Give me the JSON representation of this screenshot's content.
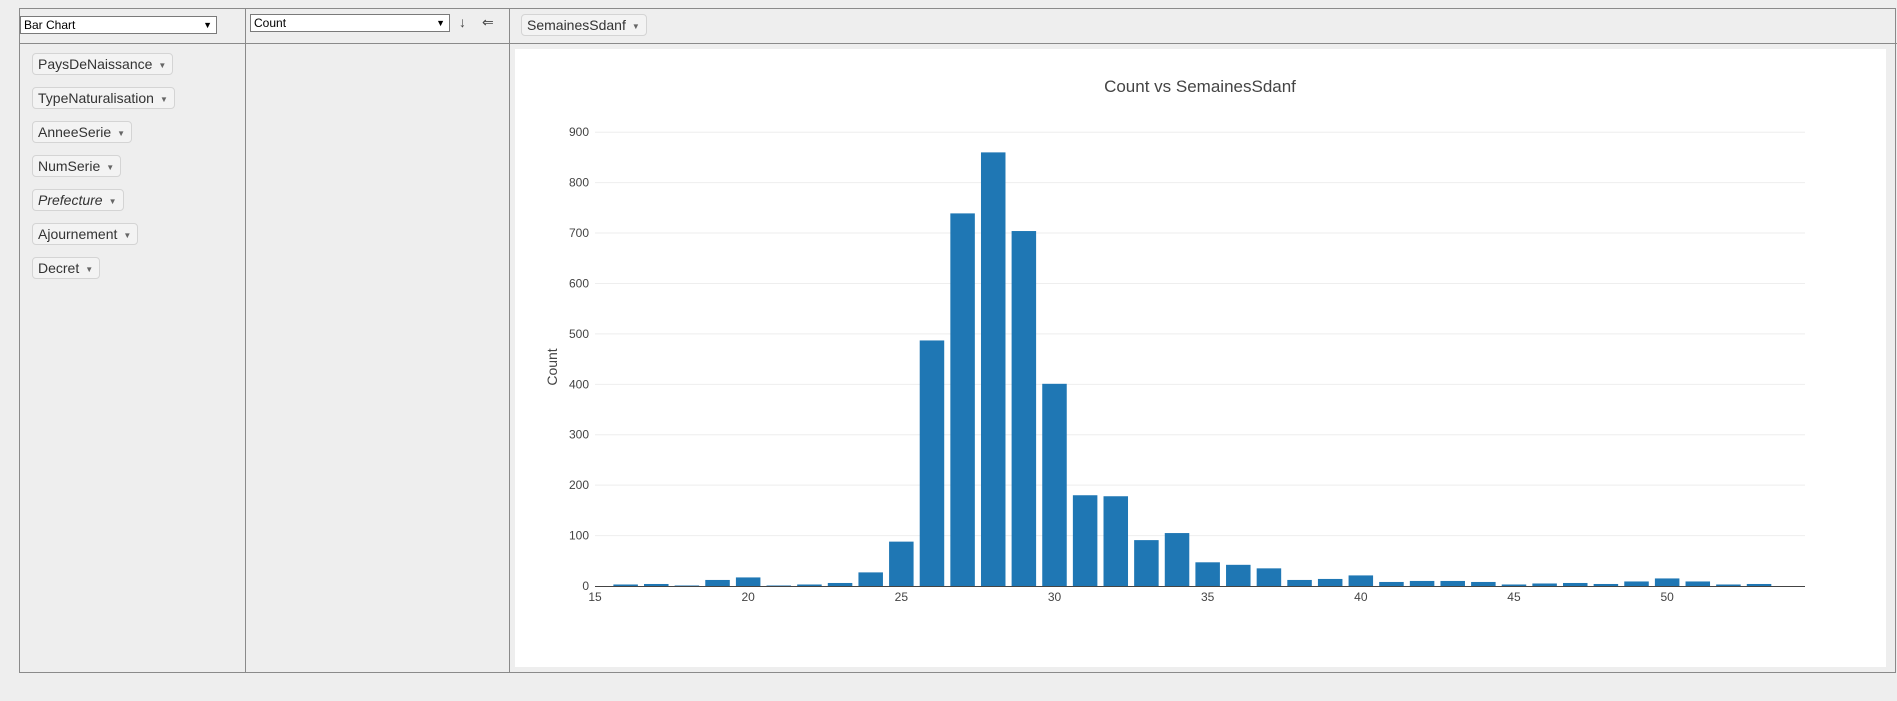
{
  "renderer": {
    "selected": "Bar Chart"
  },
  "aggregator": {
    "selected": "Count"
  },
  "sort_icons": {
    "rows": "↓",
    "cols": "⇐"
  },
  "column_attributes": [
    {
      "label": "SemainesSdanf"
    }
  ],
  "unused_attributes": [
    {
      "label": "PaysDeNaissance",
      "italic": false
    },
    {
      "label": "TypeNaturalisation",
      "italic": false
    },
    {
      "label": "AnneeSerie",
      "italic": false
    },
    {
      "label": "NumSerie",
      "italic": false
    },
    {
      "label": "Prefecture",
      "italic": true
    },
    {
      "label": "Ajournement",
      "italic": false
    },
    {
      "label": "Decret",
      "italic": false
    }
  ],
  "chart_data": {
    "type": "bar",
    "title": "Count vs SemainesSdanf",
    "xlabel": "",
    "ylabel": "Count",
    "xlim": [
      15,
      54.5
    ],
    "ylim": [
      0,
      950
    ],
    "xticks": [
      15,
      20,
      25,
      30,
      35,
      40,
      45,
      50
    ],
    "yticks": [
      0,
      100,
      200,
      300,
      400,
      500,
      600,
      700,
      800,
      900
    ],
    "grid": true,
    "color": "#1f77b4",
    "x": [
      16,
      17,
      18,
      19,
      20,
      21,
      22,
      23,
      24,
      25,
      26,
      27,
      28,
      29,
      30,
      31,
      32,
      33,
      34,
      35,
      36,
      37,
      38,
      39,
      40,
      41,
      42,
      43,
      44,
      45,
      46,
      47,
      48,
      49,
      50,
      51,
      52,
      53
    ],
    "values": [
      3,
      4,
      1,
      12,
      17,
      1,
      3,
      6,
      27,
      88,
      487,
      739,
      860,
      704,
      401,
      180,
      178,
      91,
      105,
      47,
      42,
      35,
      12,
      14,
      21,
      8,
      10,
      10,
      8,
      3,
      5,
      6,
      4,
      9,
      15,
      9,
      3,
      4
    ]
  }
}
